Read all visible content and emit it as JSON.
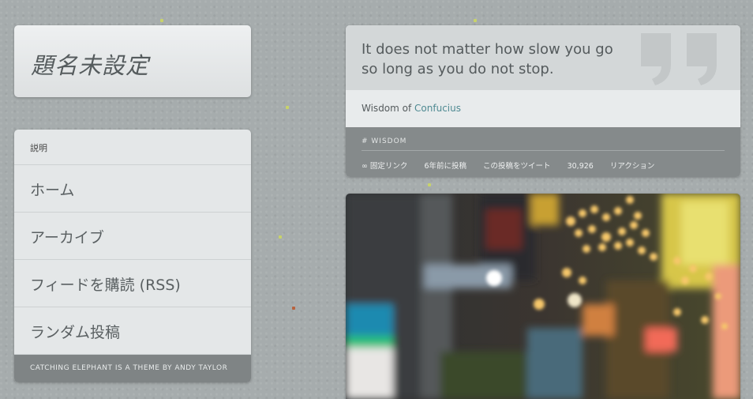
{
  "blog": {
    "title": "題名未設定"
  },
  "nav": {
    "description_label": "説明",
    "items": [
      {
        "label": "ホーム"
      },
      {
        "label": "アーカイブ"
      },
      {
        "label": "フィードを購読 (RSS)"
      },
      {
        "label": "ランダム投稿"
      }
    ],
    "footer": "CATCHING ELEPHANT IS A THEME BY ANDY TAYLOR"
  },
  "quote_post": {
    "text": "It does not matter how slow you go so long as you do not stop.",
    "source_prefix": "Wisdom of ",
    "source_name": "Confucius",
    "tag": "# WISDOM",
    "permalink": "∞ 固定リンク",
    "posted": "6年前に投稿",
    "tweet": "この投稿をツイート",
    "reactions_count": "30,926",
    "reactions_label": " リアクション"
  },
  "colors": {
    "background": "#a6acad",
    "link": "#4f8a92",
    "meta_bar": "#858a8b"
  }
}
